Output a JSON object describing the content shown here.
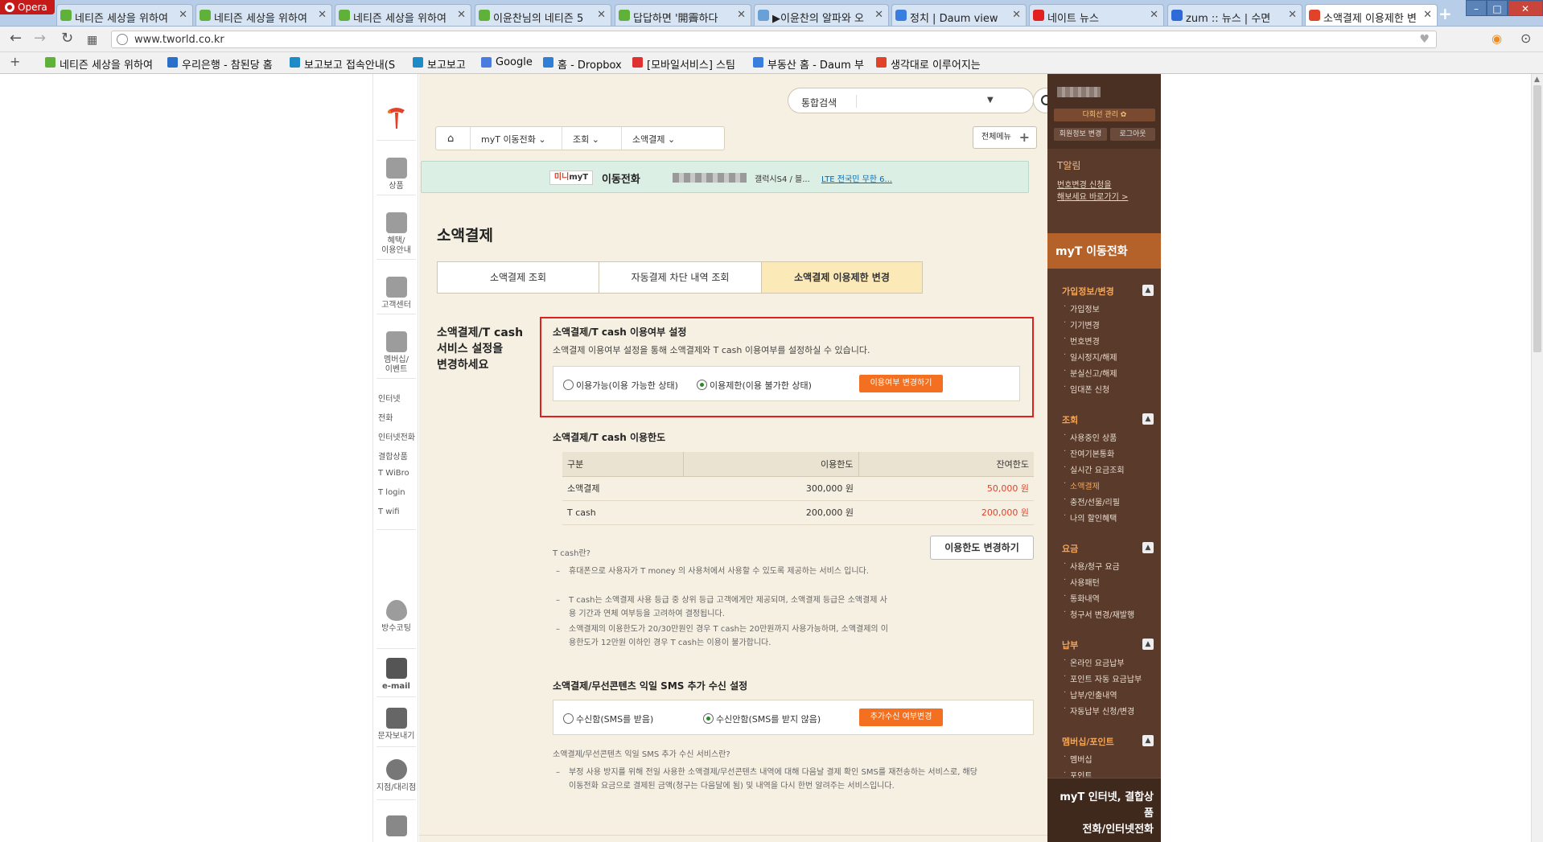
{
  "browser": {
    "opera_label": "Opera",
    "tabs": [
      {
        "title": "네티즌 세상을 위하여",
        "fav": "#5fb13a"
      },
      {
        "title": "네티즌 세상을 위하여",
        "fav": "#5fb13a"
      },
      {
        "title": "네티즌 세상을 위하여",
        "fav": "#5fb13a"
      },
      {
        "title": "이윤찬님의 네티즌 5",
        "fav": "#5fb13a"
      },
      {
        "title": "답답하면 '開霽하다",
        "fav": "#5fb13a"
      },
      {
        "title": "▶이윤찬의 알파와 오",
        "fav": "#6aa0d8"
      },
      {
        "title": "정치 | Daum view",
        "fav": "#3a7de0"
      },
      {
        "title": "네이트 뉴스",
        "fav": "#e22020"
      },
      {
        "title": "zum :: 뉴스 | 수면",
        "fav": "#2e6ad8"
      },
      {
        "title": "소액결제 이용제한 변",
        "fav": "#e0432a"
      }
    ],
    "new_tab": "+",
    "url": "www.tworld.co.kr",
    "bookmarks": [
      {
        "label": "네티즌 세상을 위하여",
        "color": "#5fb13a"
      },
      {
        "label": "우리은행 - 참된당 홈",
        "color": "#2a6fc8"
      },
      {
        "label": "보고보고 접속안내(S",
        "color": "#1e8ac7"
      },
      {
        "label": "보고보고",
        "color": "#1e8ac7"
      },
      {
        "label": "Google",
        "color": "#4a7ce0"
      },
      {
        "label": "홈 - Dropbox",
        "color": "#2f7fd8"
      },
      {
        "label": "[모바일서비스] 스팀",
        "color": "#e03030"
      },
      {
        "label": "부동산 홈 - Daum 부",
        "color": "#3a7de0"
      },
      {
        "label": "생각대로 이루어지는",
        "color": "#e0432a"
      }
    ]
  },
  "leftnav": {
    "items": [
      "상품",
      "혜택/\n이용안내",
      "고객센터",
      "멤버십/\n이벤트"
    ],
    "links": [
      "인터넷",
      "전화",
      "인터넷전화",
      "결합상품",
      "T WiBro",
      "T login",
      "T wifi"
    ],
    "tools": [
      "방수코팅",
      "e-mail",
      "문자보내기",
      "지점/대리점"
    ]
  },
  "header": {
    "search_label": "통합검색",
    "crumbs": [
      "myT 이동전화",
      "조회",
      "소액결제"
    ],
    "all_menu": "전체메뉴"
  },
  "mini": {
    "badge_a": "미니",
    "badge_b": "myT",
    "type": "이동전화",
    "device": "갤럭시S4 / 블...",
    "plan": "LTE 전국민 무한 6..."
  },
  "page": {
    "title": "소액결제",
    "tabs": [
      "소액결제 조회",
      "자동결제 차단 내역 조회",
      "소액결제 이용제한 변경"
    ],
    "side_heading": "소액결제/T cash\n서비스 설정을\n변경하세요"
  },
  "usage": {
    "title": "소액결제/T cash 이용여부 설정",
    "desc": "소액결제 이용여부 설정을 통해 소액결제와 T cash 이용여부를 설정하실 수 있습니다.",
    "opt1": "이용가능(이용 가능한 상태)",
    "opt2": "이용제한(이용 불가한 상태)",
    "btn": "이용여부 변경하기"
  },
  "limit": {
    "title": "소액결제/T cash 이용한도",
    "headers": [
      "구분",
      "이용한도",
      "잔여한도"
    ],
    "rows": [
      {
        "name": "소액결제",
        "limit": "300,000 원",
        "remain": "50,000 원"
      },
      {
        "name": "T cash",
        "limit": "200,000 원",
        "remain": "200,000 원"
      }
    ],
    "change_btn": "이용한도 변경하기",
    "note_title": "T cash란?",
    "notes": [
      "휴대폰으로 사용자가 T money 의 사용처에서 사용할 수 있도록 제공하는 서비스 입니다.",
      "T cash는 소액결제 사용 등급 중 상위 등급 고객에게만 제공되며, 소액결제 등급은 소액결제 사용 기간과 연체 여부등을 고려하여 결정됩니다.",
      "소액결제의 이용한도가 20/30만원인 경우 T cash는 20만원까지 사용가능하며, 소액결제의 이용한도가 12만원 이하인 경우 T cash는 이용이 불가합니다."
    ]
  },
  "sms": {
    "title": "소액결제/무선콘텐츠 익일 SMS 추가 수신 설정",
    "opt1": "수신함(SMS를 받음)",
    "opt2": "수신안함(SMS를 받지 않음)",
    "btn": "추가수신 여부변경",
    "note_title": "소액결제/무선콘텐츠 익일 SMS 추가 수신 서비스란?",
    "notes": [
      "부정 사용 방지를 위해 전일 사용한 소액결제/무선콘텐츠 내역에 대해 다음날 결제 확인 SMS를 재전송하는 서비스로, 해당 이동전화 요금으로 결제된 금액(청구는 다음달에 됨) 및 내역을 다시 한번 알려주는 서비스입니다."
    ]
  },
  "rside": {
    "manage": "다회선 관리 ✿",
    "btn1": "회원정보 변경",
    "btn2": "로그아웃",
    "alarm_title": "T알림",
    "alarm_l1": "번호변경 신청을",
    "alarm_l2": "해보세요 바로가기 >",
    "myt": "myT 이동전화",
    "cats": [
      {
        "name": "가입정보/변경",
        "links": [
          "가입정보",
          "기기변경",
          "번호변경",
          "일시정지/해제",
          "분실신고/해제",
          "임대폰 신청"
        ]
      },
      {
        "name": "조회",
        "links": [
          "사용중인 상품",
          "잔여기본통화",
          "실시간 요금조회",
          "소액결제",
          "충전/선물/리필",
          "나의 할인혜택"
        ]
      },
      {
        "name": "요금",
        "links": [
          "사용/청구 요금",
          "사용패턴",
          "통화내역",
          "청구서 변경/재발행"
        ]
      },
      {
        "name": "납부",
        "links": [
          "온라인 요금납부",
          "포인트 자동 요금납부",
          "납부/인출내역",
          "자동납부 신청/변경"
        ]
      },
      {
        "name": "멤버십/포인트",
        "links": [
          "멤버십",
          "포인트"
        ]
      }
    ],
    "bottom": "myT 인터넷, 결합상품\n전화/인터넷전화"
  }
}
